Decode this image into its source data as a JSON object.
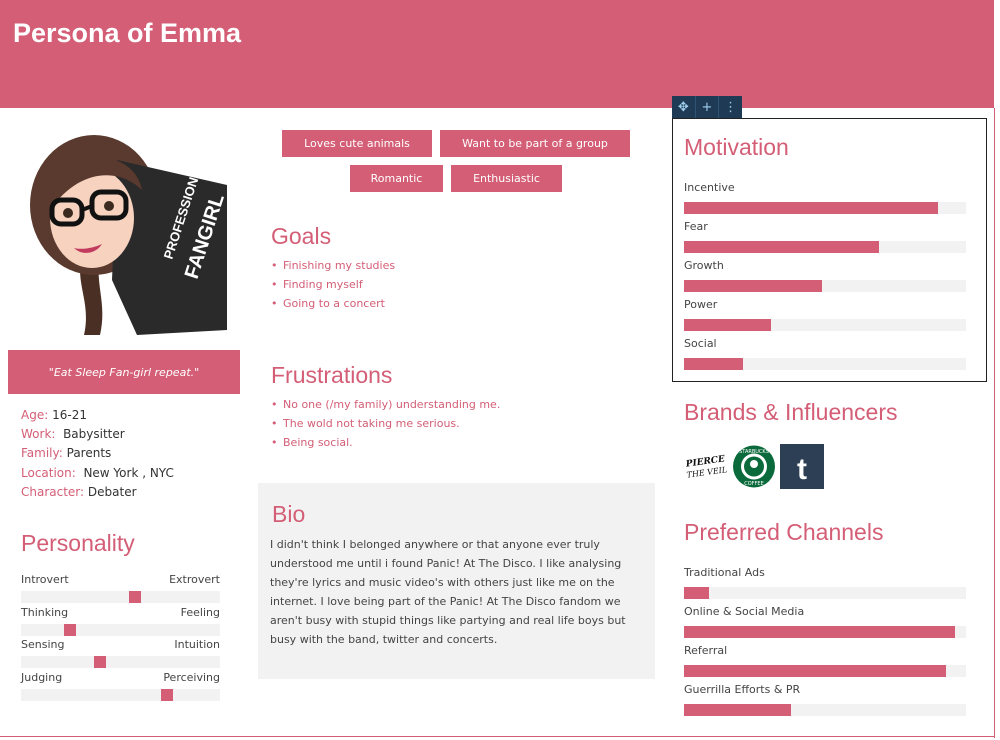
{
  "header": {
    "title": "Persona of Emma"
  },
  "profile": {
    "avatar_text": [
      "PROFESSIONAL",
      "FANGIRL"
    ],
    "quote": "\"Eat  Sleep  Fan-girl  repeat.\"",
    "facts": [
      {
        "key": "Age:",
        "value": "16-21"
      },
      {
        "key": "Work:",
        "value": "Babysitter"
      },
      {
        "key": "Family:",
        "value": "Parents"
      },
      {
        "key": "Location:",
        "value": "New York , NYC"
      },
      {
        "key": "Character:",
        "value": "Debater"
      }
    ]
  },
  "personality": {
    "title": "Personality",
    "scales": [
      {
        "left": "Introvert",
        "right": "Extrovert",
        "position": 0.58
      },
      {
        "left": "Thinking",
        "right": "Feeling",
        "position": 0.23
      },
      {
        "left": "Sensing",
        "right": "Intuition",
        "position": 0.39
      },
      {
        "left": "Judging",
        "right": "Perceiving",
        "position": 0.75
      }
    ]
  },
  "tags": [
    "Loves cute animals",
    "Want to be part of a group",
    "Romantic",
    "Enthusiastic"
  ],
  "goals": {
    "title": "Goals",
    "items": [
      "Finishing my studies",
      "Finding myself",
      "Going to a concert"
    ]
  },
  "frustrations": {
    "title": "Frustrations",
    "items": [
      "No one (/my family) understanding me.",
      "The wold not taking me serious.",
      "Being social."
    ]
  },
  "bio": {
    "title": "Bio",
    "text": "I didn't think I belonged anywhere or that anyone ever truly understood me until i found Panic! At The Disco. I like analysing they're lyrics and music video's with others just like me on the internet.  I love being part of the Panic! At The Disco fandom we aren't busy with stupid things like partying and real life boys but busy with the band, twitter and concerts."
  },
  "motivation": {
    "title": "Motivation",
    "items": [
      {
        "label": "Incentive",
        "value": 0.9
      },
      {
        "label": "Fear",
        "value": 0.69
      },
      {
        "label": "Growth",
        "value": 0.49
      },
      {
        "label": "Power",
        "value": 0.31
      },
      {
        "label": "Social",
        "value": 0.21
      }
    ]
  },
  "brands": {
    "title": "Brands & Influencers",
    "logos": [
      {
        "name": "pierce-the-veil-logo",
        "text": "PIERCE THE VEIL"
      },
      {
        "name": "starbucks-logo",
        "text": "STARBUCKS COFFEE"
      },
      {
        "name": "tumblr-logo",
        "text": "t"
      }
    ]
  },
  "channels": {
    "title": "Preferred Channels",
    "items": [
      {
        "label": "Traditional Ads",
        "value": 0.09
      },
      {
        "label": "Online & Social Media",
        "value": 0.96
      },
      {
        "label": "Referral",
        "value": 0.93
      },
      {
        "label": "Guerrilla Efforts & PR",
        "value": 0.38
      }
    ]
  },
  "toolbar": {
    "icons": [
      "move-icon",
      "add-icon",
      "more-icon"
    ]
  },
  "colors": {
    "accent": "#d35e76",
    "track": "#f2f2f2",
    "toolbar": "#1f3a55"
  }
}
